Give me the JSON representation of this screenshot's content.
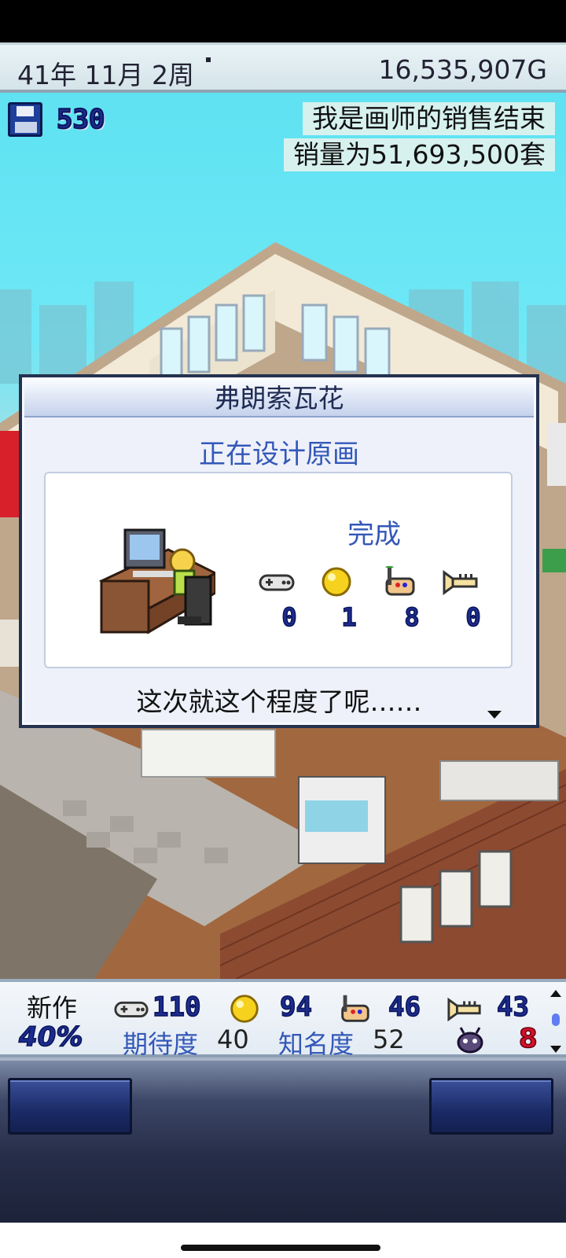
{
  "top_bar": {
    "date": "41年 11月 2周",
    "money": "16,535,907G"
  },
  "scene": {
    "save_count": "530",
    "notice_line1": "我是画师的销售结束",
    "notice_line2": "销量为51,693,500套"
  },
  "dialog": {
    "title": "弗朗索瓦花",
    "subtitle": "正在设计原画",
    "done_label": "完成",
    "stats": [
      {
        "icon": "controller-icon",
        "value": "0"
      },
      {
        "icon": "lightbulb-icon",
        "value": "1"
      },
      {
        "icon": "paint-palette-icon",
        "value": "8"
      },
      {
        "icon": "trumpet-icon",
        "value": "0"
      }
    ],
    "message": "这次就这个程度了呢……"
  },
  "panel": {
    "new_label": "新作",
    "progress": "40%",
    "fun": "110",
    "creativity": "94",
    "graphics": "46",
    "sound": "43",
    "expectation_label": "期待度",
    "expectation_value": "40",
    "fame_label": "知名度",
    "fame_value": "52",
    "bugs": "8"
  },
  "colors": {
    "accent_blue": "#3458b8",
    "number_navy": "#1c2c8e",
    "bug_red": "#d3112a"
  }
}
